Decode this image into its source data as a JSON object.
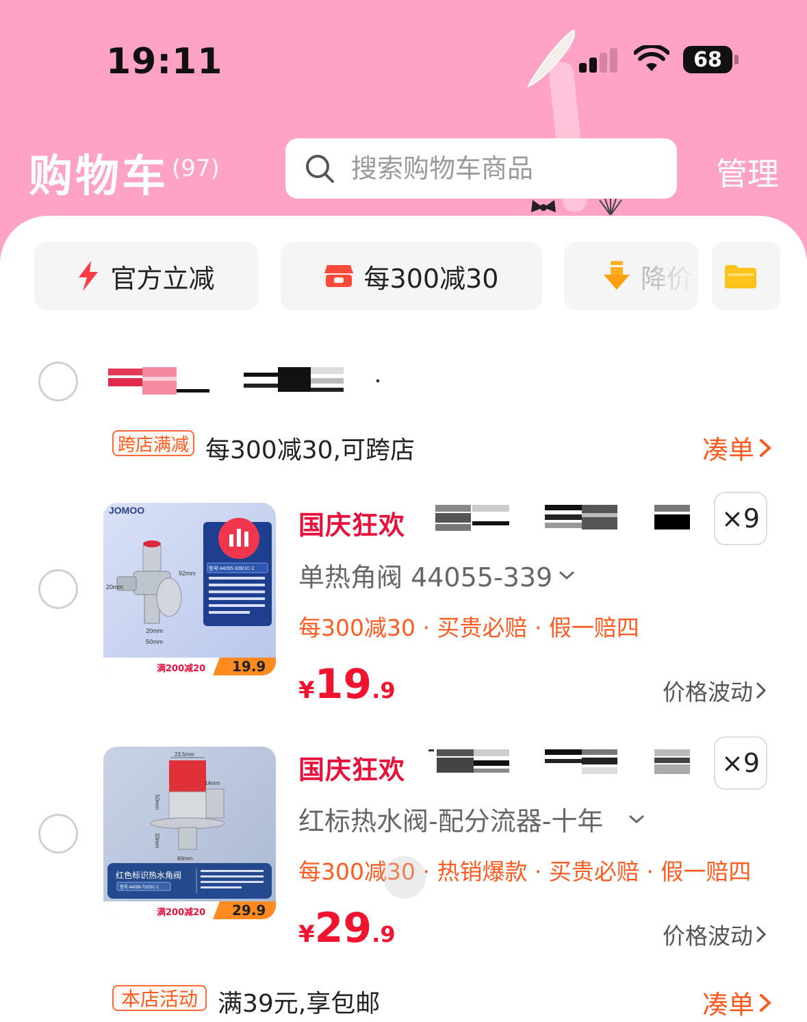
{
  "status_bar": {
    "time": "19:11",
    "battery": "68"
  },
  "header": {
    "title": "购物车",
    "count": "(97)",
    "search_placeholder": "搜索购物车商品",
    "manage": "管理"
  },
  "filters": [
    {
      "label": "官方立减",
      "icon": "lightning-icon"
    },
    {
      "label": "每300减30",
      "icon": "store-icon"
    },
    {
      "label": "降价",
      "icon": "arrow-down-icon"
    },
    {
      "label": "",
      "icon": "folder-icon"
    }
  ],
  "store": {
    "promo_tag": "跨店满减",
    "promo_text": "每300减30,可跨店",
    "link": "凑单"
  },
  "products": [
    {
      "badge": "国庆狂欢",
      "qty": "×9",
      "sku": "单热角阀 44055-339",
      "promo": "每300减30 · 买贵必赔 · 假一赔四",
      "price_currency": "¥",
      "price_int": "19",
      "price_dec": ".9",
      "trend": "价格波动",
      "thumb": {
        "brand": "JOMOO",
        "model": "型号:44055-339/1C-1",
        "note": "*安装时，请在进水口螺纹处缠上适量生料带，对准管道上的螺纹旋上5-6个牙确保不漏水即可，同时调整出水口方向。",
        "dim_a": "92mm",
        "dim_b": "20mm",
        "dim_c": "20mm",
        "dim_d": "50mm",
        "promo": "满200减20",
        "price": "19.9"
      }
    },
    {
      "badge": "国庆狂欢",
      "qty": "×9",
      "sku": "红标热水阀-配分流器-十年",
      "promo": "每300减30 · 热销爆款 · 买贵必赔 · 假一赔四",
      "price_currency": "¥",
      "price_int": "29",
      "price_dec": ".9",
      "trend": "价格波动",
      "thumb": {
        "label": "红色标识热水角阀",
        "model": "型号:44098-732/5C-1",
        "dim_a": "23.5mm",
        "dim_b": "14mm",
        "dim_c": "50mm",
        "dim_d": "33mm",
        "dim_e": "60mm",
        "promo": "满200减20",
        "price": "29.9"
      }
    }
  ],
  "shop_activity": {
    "tag": "本店活动",
    "text": "满39元,享包邮",
    "link": "凑单"
  },
  "colors": {
    "accent": "#ff5a1f",
    "price": "#f0142f",
    "header_bg": "#ffa3c6"
  }
}
